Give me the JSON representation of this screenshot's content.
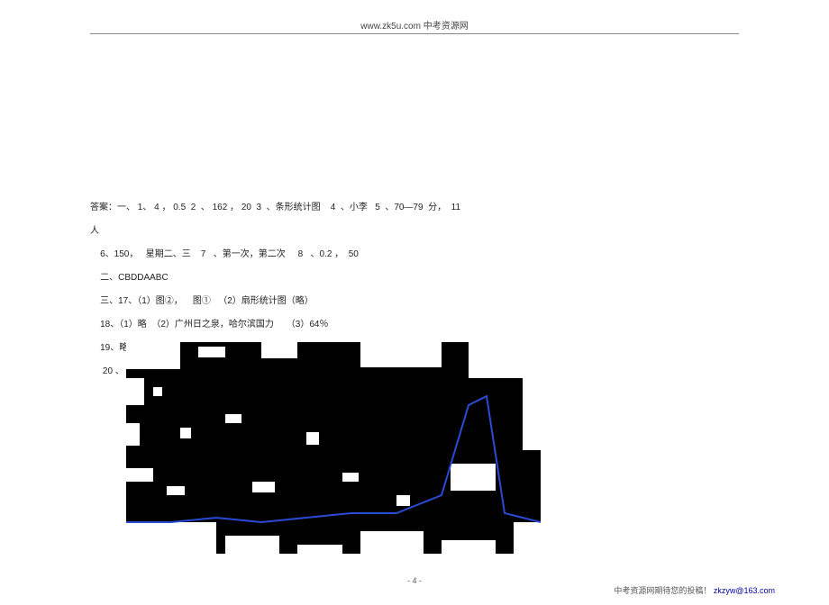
{
  "header": {
    "url": "www.zk5u.com",
    "site_name": "中考资源网"
  },
  "answers": {
    "line1": "答案：一、 1、 4 ， 0.5  2  、 162 ， 20  3  、条形统计图    4  、小李   5  、70—79  分，  11",
    "line2": "人",
    "line3": "    6、150，   星期二、三    7   、第一次，第二次     8   、0.2 ，  50",
    "line4": "    二、CBDDAABC",
    "line5": "    三、17、（1）图②，    图①   （2）扇形统计图（略）",
    "line6": "    18、（1）略  （2）广州日之泉，哈尔滨国力     （3）64％",
    "line7": "    19、略",
    "line8": "     20 、"
  },
  "page": {
    "number": "- 4 -"
  },
  "footer": {
    "text": "中考资源网期待您的投稿！",
    "email": "zkzyw@163.com"
  },
  "chart_data": {
    "type": "line",
    "description": "heavily degraded/noisy black region with a blue line curve peaking near the right side",
    "x": [
      0,
      50,
      100,
      150,
      200,
      250,
      300,
      350,
      380,
      400,
      420,
      460
    ],
    "y": [
      200,
      200,
      195,
      200,
      195,
      190,
      190,
      170,
      70,
      60,
      190,
      200
    ],
    "line_color": "#2b4bd6",
    "background": "#000000"
  }
}
